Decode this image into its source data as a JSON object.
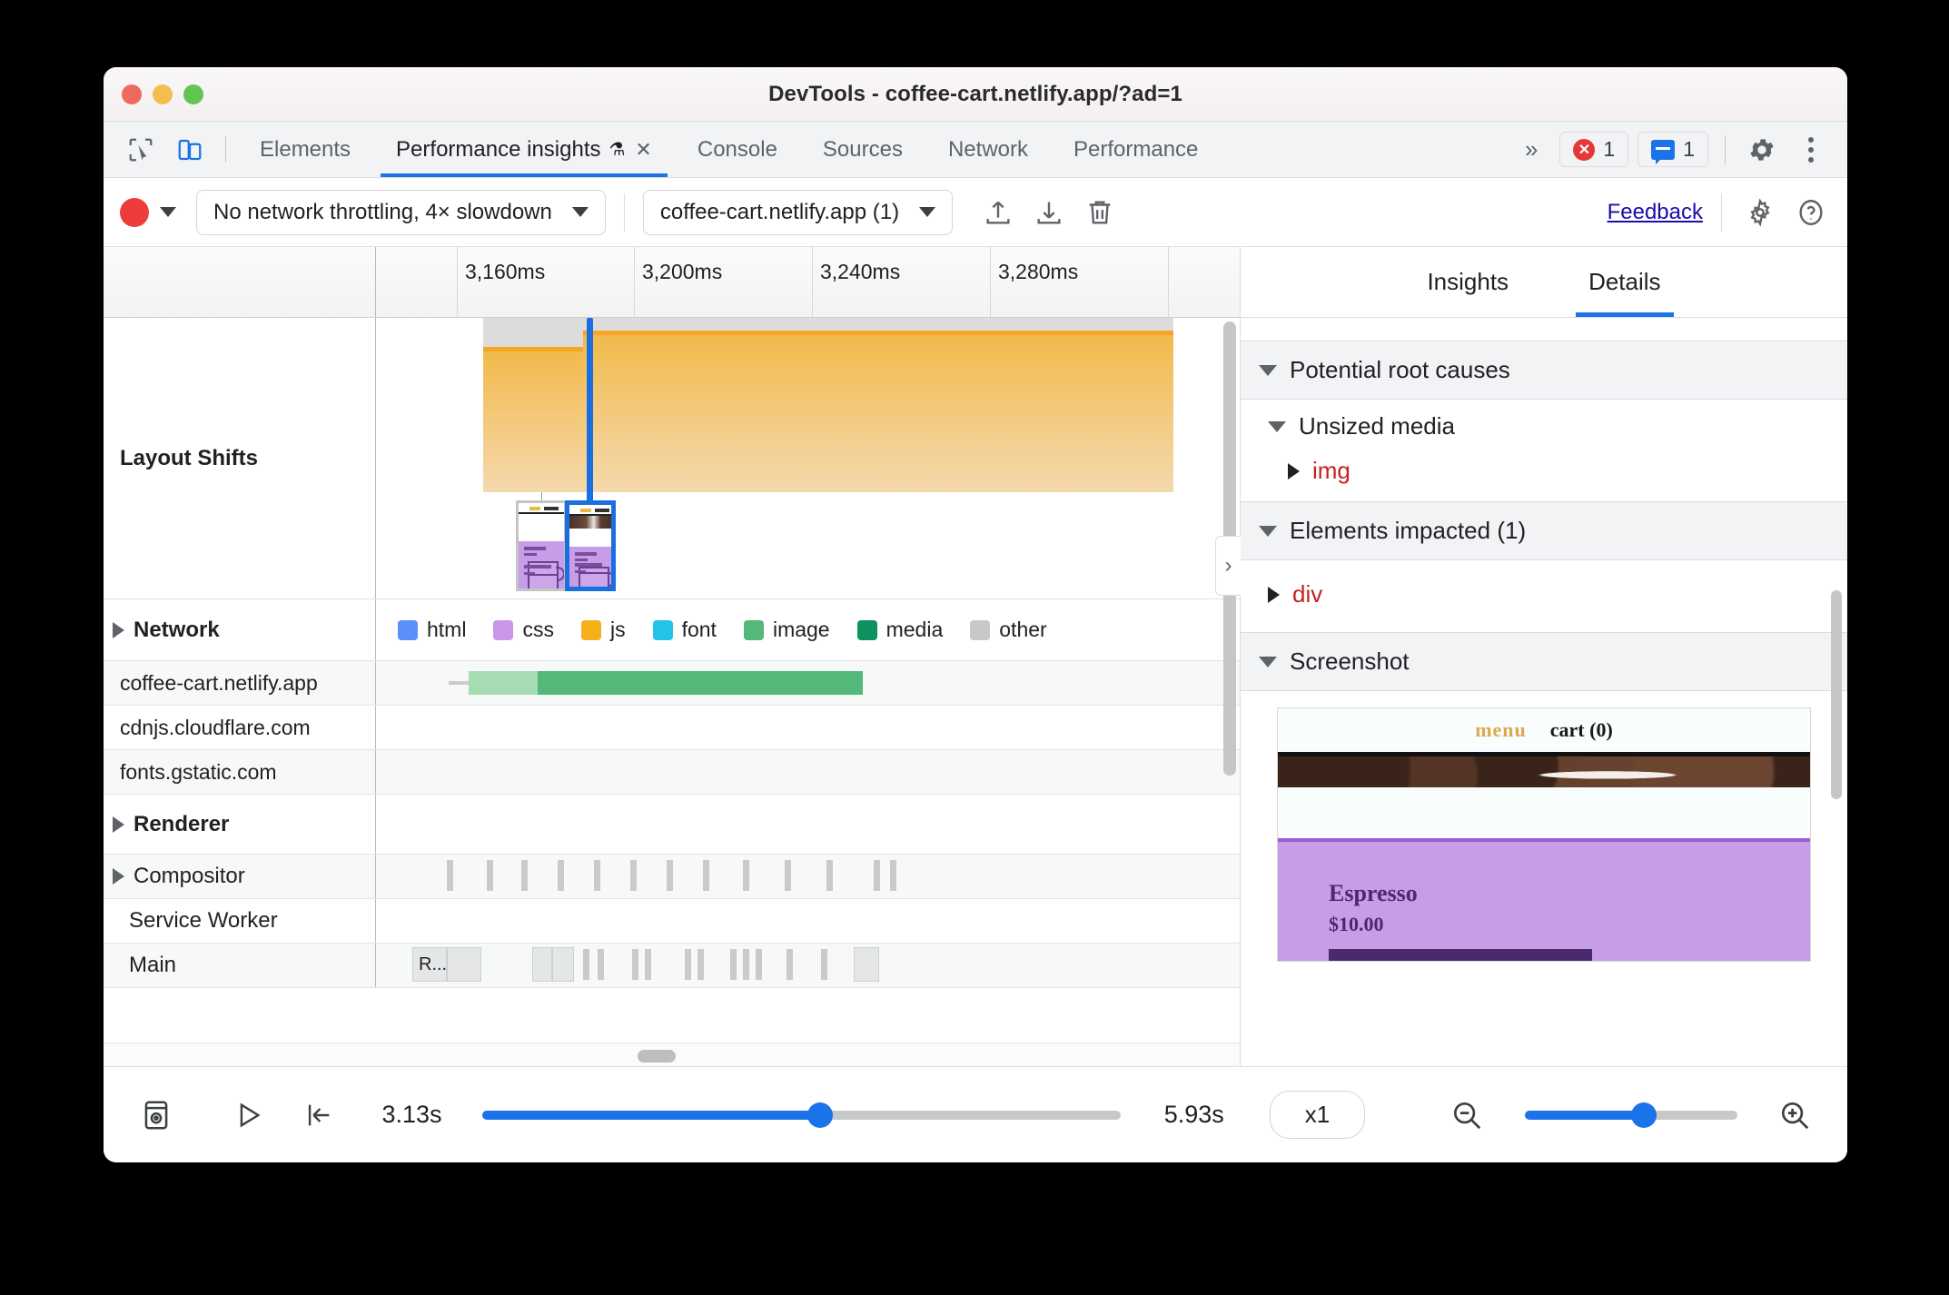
{
  "window": {
    "title": "DevTools - coffee-cart.netlify.app/?ad=1"
  },
  "tabbar": {
    "inspect_icon": "cursor-select-icon",
    "device_icon": "device-toolbar-icon",
    "tabs": [
      {
        "label": "Elements",
        "active": false
      },
      {
        "label": "Performance insights",
        "active": true,
        "flask": "⚗",
        "close": "✕"
      },
      {
        "label": "Console",
        "active": false
      },
      {
        "label": "Sources",
        "active": false
      },
      {
        "label": "Network",
        "active": false
      },
      {
        "label": "Performance",
        "active": false
      }
    ],
    "more_tabs": "»",
    "error_count": "1",
    "message_count": "1",
    "settings_icon": "gear-icon",
    "menu_icon": "kebab-menu-icon"
  },
  "toolbar": {
    "record_label": "record-button",
    "throttling": "No network throttling, 4× slowdown",
    "page_select": "coffee-cart.netlify.app (1)",
    "upload_icon": "upload-icon",
    "download_icon": "download-icon",
    "trash_icon": "trash-icon",
    "feedback": "Feedback",
    "settings_icon": "gear-icon",
    "help_icon": "help-icon"
  },
  "timeline": {
    "ruler_ticks": [
      "3,160ms",
      "3,200ms",
      "3,240ms",
      "3,280ms"
    ],
    "tracks": {
      "layout_shifts": "Layout Shifts",
      "network_group": "Network",
      "network_rows": [
        "coffee-cart.netlify.app",
        "cdnjs.cloudflare.com",
        "fonts.gstatic.com"
      ],
      "renderer": "Renderer",
      "compositor": "Compositor",
      "service_worker": "Service Worker",
      "main": "Main",
      "main_task_label": "R..."
    },
    "legend": [
      {
        "label": "html",
        "color": "#5b8ff9"
      },
      {
        "label": "css",
        "color": "#cb95e8"
      },
      {
        "label": "js",
        "color": "#f5b01a"
      },
      {
        "label": "font",
        "color": "#22c3e6"
      },
      {
        "label": "image",
        "color": "#53b87a"
      },
      {
        "label": "media",
        "color": "#0f9160"
      },
      {
        "label": "other",
        "color": "#c6c8ca"
      }
    ]
  },
  "sidebar": {
    "tabs": [
      {
        "label": "Insights",
        "active": false
      },
      {
        "label": "Details",
        "active": true
      }
    ],
    "sections": {
      "root_causes": "Potential root causes",
      "unsized_media": "Unsized media",
      "unsized_media_item": "img",
      "elements_impacted": "Elements impacted (1)",
      "elements_impacted_item": "div",
      "screenshot": "Screenshot"
    },
    "screenshot_preview": {
      "menu": "menu",
      "cart": "cart (0)",
      "product": "Espresso",
      "price": "$10.00"
    },
    "collapse_handle": "›"
  },
  "bottombar": {
    "filmstrip_icon": "screenshot-toggle-icon",
    "play_icon": "play-icon",
    "jump_start_icon": "jump-to-start-icon",
    "start_time": "3.13s",
    "end_time": "5.93s",
    "speed": "x1",
    "zoom_out_icon": "zoom-out-icon",
    "zoom_in_icon": "zoom-in-icon",
    "range_percent": 53,
    "zoom_percent": 56
  }
}
